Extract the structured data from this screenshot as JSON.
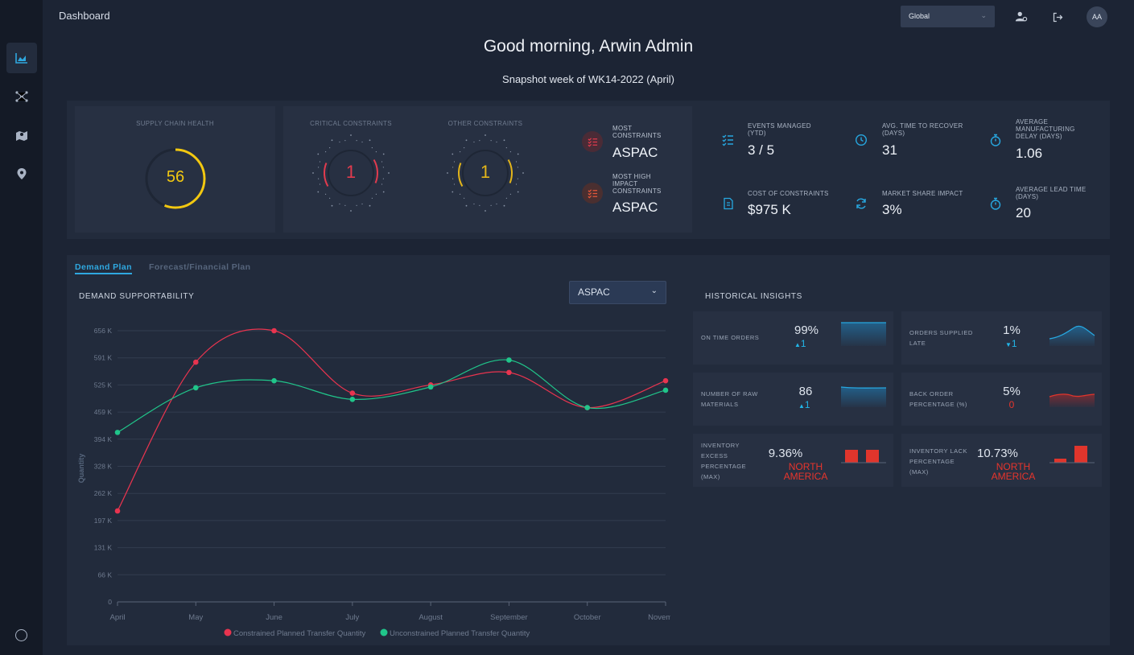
{
  "app": {
    "title": "Dashboard",
    "region_select": "Global",
    "avatar_initials": "AA",
    "greeting": "Good morning, Arwin Admin",
    "snapshot": "Snapshot week of WK14-2022 (April)"
  },
  "health": {
    "label": "SUPPLY CHAIN HEALTH",
    "value": "56",
    "gauge_color": "#f2c811"
  },
  "constraints": {
    "critical_label": "CRITICAL CONSTRAINTS",
    "critical_value": "1",
    "critical_color": "#e23b4e",
    "other_label": "OTHER CONSTRAINTS",
    "other_value": "1",
    "other_color": "#e3b51a",
    "most_label": "MOST CONSTRAINTS",
    "most_value": "ASPAC",
    "high_label": "MOST HIGH IMPACT CONSTRAINTS",
    "high_value": "ASPAC"
  },
  "metrics": [
    {
      "label": "EVENTS MANAGED (YTD)",
      "value": "3 / 5",
      "icon": "checklist-icon"
    },
    {
      "label": "AVG. TIME TO RECOVER (DAYS)",
      "value": "31",
      "icon": "clock-icon"
    },
    {
      "label": "AVERAGE MANUFACTURING DELAY (DAYS)",
      "value": "1.06",
      "icon": "stopwatch-icon"
    },
    {
      "label": "COST OF CONSTRAINTS",
      "value": "$975 K",
      "icon": "invoice-icon"
    },
    {
      "label": "MARKET SHARE IMPACT",
      "value": "3%",
      "icon": "refresh-icon"
    },
    {
      "label": "AVERAGE LEAD TIME (DAYS)",
      "value": "20",
      "icon": "stopwatch-icon"
    }
  ],
  "tabs": [
    "Demand Plan",
    "Forecast/Financial Plan"
  ],
  "demand": {
    "title": "DEMAND SUPPORTABILITY",
    "region": "ASPAC"
  },
  "insights": {
    "title": "HISTORICAL INSIGHTS",
    "items": [
      {
        "label": "ON TIME ORDERS",
        "value": "99%",
        "delta": "1",
        "delta_dir": "up"
      },
      {
        "label": "ORDERS SUPPLIED LATE",
        "value": "1%",
        "delta": "1",
        "delta_dir": "down"
      },
      {
        "label": "NUMBER OF RAW MATERIALS",
        "value": "86",
        "delta": "1",
        "delta_dir": "up"
      },
      {
        "label": "BACK ORDER PERCENTAGE (%)",
        "value": "5%",
        "delta": "0"
      },
      {
        "label": "INVENTORY EXCESS PERCENTAGE (MAX)",
        "value": "9.36%",
        "region": "NORTH AMERICA"
      },
      {
        "label": "INVENTORY LACK PERCENTAGE (MAX)",
        "value": "10.73%",
        "region": "NORTH AMERICA"
      }
    ]
  },
  "chart_data": {
    "type": "line",
    "ylabel": "Quantity",
    "categories": [
      "April",
      "May",
      "June",
      "July",
      "August",
      "September",
      "October",
      "November"
    ],
    "y_ticks": [
      "0",
      "66 K",
      "131 K",
      "197 K",
      "262 K",
      "328 K",
      "394 K",
      "459 K",
      "525 K",
      "591 K",
      "656 K"
    ],
    "ylim": [
      0,
      656
    ],
    "series": [
      {
        "name": "Constrained Planned Transfer Quantity",
        "color": "#e8344f",
        "values": [
          220,
          580,
          656,
          505,
          525,
          555,
          470,
          535
        ]
      },
      {
        "name": "Unconstrained Planned Transfer Quantity",
        "color": "#20c58a",
        "values": [
          410,
          518,
          535,
          490,
          520,
          585,
          470,
          512
        ]
      }
    ],
    "grid": true,
    "legend": "bottom"
  }
}
